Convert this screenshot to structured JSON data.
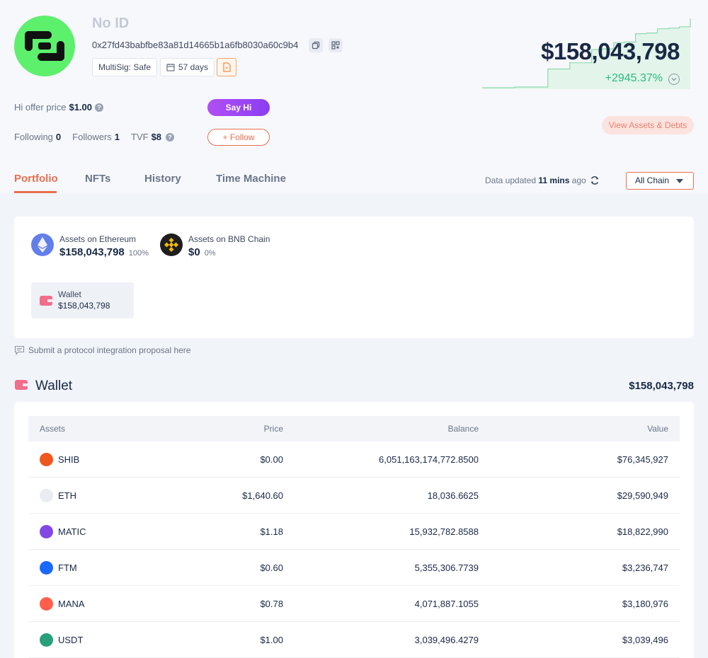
{
  "profile": {
    "name": "No ID",
    "address": "0x27fd43babfbe83a81d14665b1a6fb8030a60c9b4",
    "tags": {
      "multisig": "MultiSig: Safe",
      "days": "57 days"
    },
    "offer_label": "Hi offer price",
    "offer_value": "$1.00",
    "say_hi": "Say Hi",
    "follow": "+ Follow",
    "following_label": "Following",
    "following_count": "0",
    "followers_label": "Followers",
    "followers_count": "1",
    "tvf_label": "TVF",
    "tvf_value": "$8"
  },
  "summary": {
    "total_value": "$158,043,798",
    "change": "+2945.37%",
    "view_assets": "View Assets & Debts",
    "sparkline": [
      0.0,
      0.0,
      0.0,
      0.01,
      0.01,
      0.01,
      0.27,
      0.27,
      0.36,
      0.36,
      0.55,
      0.56,
      0.65,
      0.66,
      0.78,
      0.79,
      0.85,
      0.86,
      0.88,
      1.0
    ]
  },
  "tabs": [
    {
      "label": "Portfolio",
      "active": true
    },
    {
      "label": "NFTs",
      "active": false
    },
    {
      "label": "History",
      "active": false
    },
    {
      "label": "Time Machine",
      "active": false
    }
  ],
  "status": {
    "updated_prefix": "Data updated",
    "updated_time": "11 mins",
    "updated_suffix": "ago",
    "chain_select": "All Chain"
  },
  "chains": [
    {
      "label": "Assets on Ethereum",
      "value": "$158,043,798",
      "pct": "100%",
      "color": "#627eea"
    },
    {
      "label": "Assets on BNB Chain",
      "value": "$0",
      "pct": "0%",
      "color": "#1e1e1e"
    }
  ],
  "wallet_chip": {
    "label": "Wallet",
    "value": "$158,043,798"
  },
  "proposal": "Submit a protocol integration proposal here",
  "wallet_section": {
    "title": "Wallet",
    "total": "$158,043,798"
  },
  "table": {
    "headers": {
      "assets": "Assets",
      "price": "Price",
      "balance": "Balance",
      "value": "Value"
    },
    "rows": [
      {
        "token": "SHIB",
        "price": "$0.00",
        "balance": "6,051,163,174,772.8500",
        "value": "$76,345,927",
        "color": "#f0571c"
      },
      {
        "token": "ETH",
        "price": "$1,640.60",
        "balance": "18,036.6625",
        "value": "$29,590,949",
        "color": "#e9ecf1"
      },
      {
        "token": "MATIC",
        "price": "$1.18",
        "balance": "15,932,782.8588",
        "value": "$18,822,990",
        "color": "#8247e5"
      },
      {
        "token": "FTM",
        "price": "$0.60",
        "balance": "5,355,306.7739",
        "value": "$3,236,747",
        "color": "#1969ff"
      },
      {
        "token": "MANA",
        "price": "$0.78",
        "balance": "4,071,887.1055",
        "value": "$3,180,976",
        "color": "#ff5f4a"
      },
      {
        "token": "USDT",
        "price": "$1.00",
        "balance": "3,039,496.4279",
        "value": "$3,039,496",
        "color": "#26a17b"
      }
    ]
  }
}
